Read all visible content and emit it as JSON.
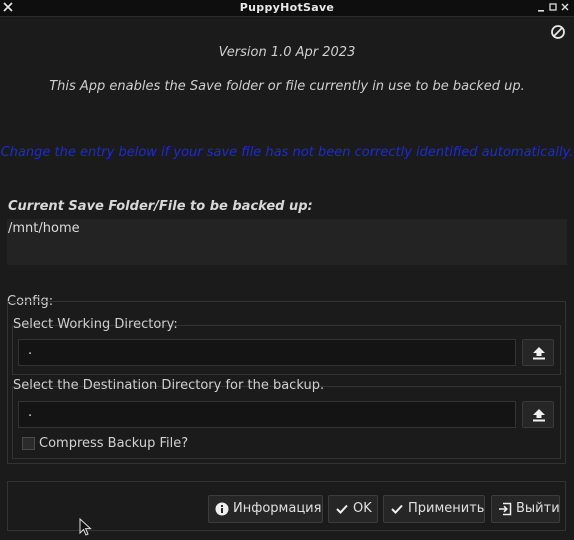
{
  "window": {
    "title": "PuppyHotSave",
    "controls": [
      "minimize",
      "maximize",
      "close"
    ]
  },
  "header": {
    "version": "Version 1.0 Apr 2023",
    "description": "This App enables the Save folder or file currently in use to be backed up.",
    "hint": "Change the entry below if your save file has not been correctly identified automatically.",
    "hint_color": "#1c2bd8"
  },
  "current": {
    "label": "Current Save Folder/File to be backed up:",
    "value": "/mnt/home"
  },
  "config": {
    "label": "Config:",
    "working_dir": {
      "label": "Select Working Directory:",
      "value": "."
    },
    "dest_dir": {
      "label": "Select the Destination Directory for the backup.",
      "value": "."
    },
    "compress": {
      "label": "Compress Backup File?",
      "checked": false
    }
  },
  "buttons": {
    "info": "Информация",
    "ok": "OK",
    "apply": "Применить",
    "quit": "Выйти"
  },
  "icons": {
    "block": "block-icon",
    "upload": "upload-icon",
    "info": "info-icon",
    "check": "check-icon",
    "exit": "exit-icon"
  }
}
